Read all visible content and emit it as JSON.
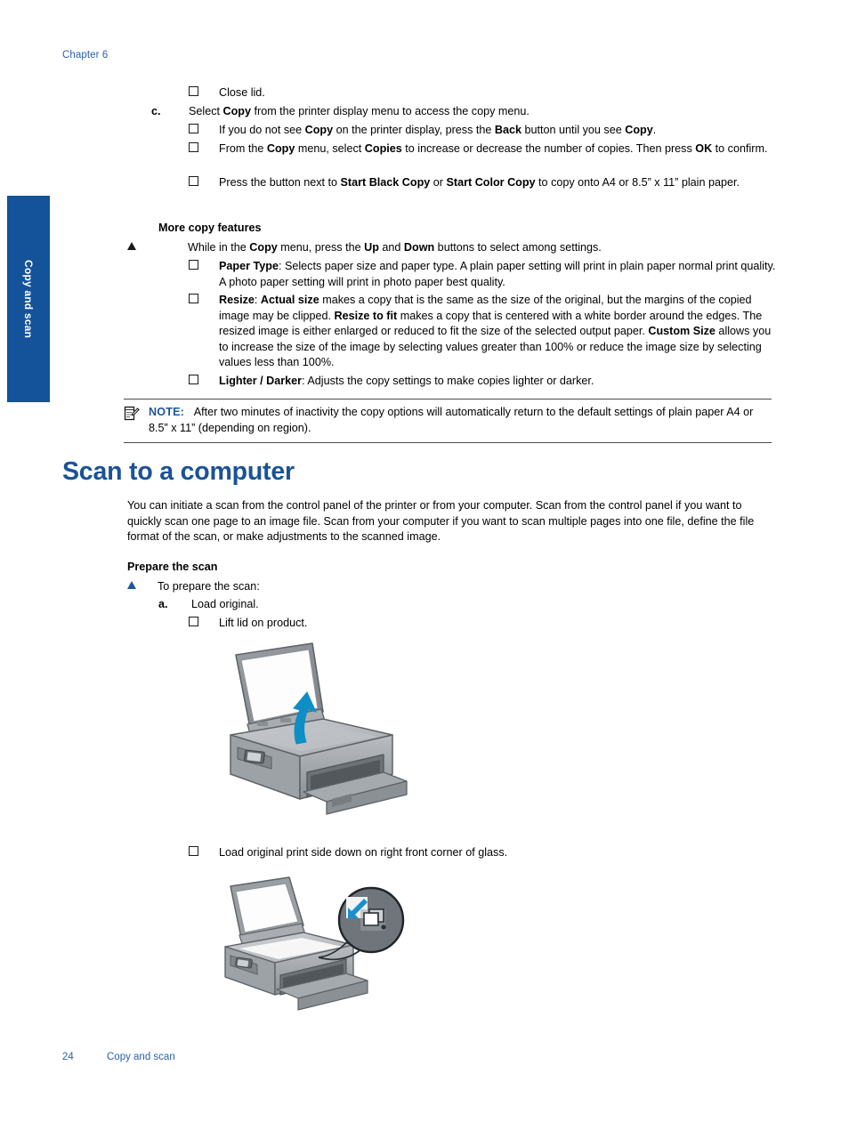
{
  "header": {
    "chapter": "Chapter 6"
  },
  "side_tab": {
    "label": "Copy and scan",
    "color": "#14529a"
  },
  "copy_steps": {
    "close_lid": "Close lid.",
    "step_c_marker": "c.",
    "step_c_parts": [
      "Select ",
      "Copy",
      " from the printer display menu to access the copy menu."
    ],
    "bullets": [
      [
        "If you do not see ",
        "Copy",
        " on the printer display, press the ",
        "Back",
        " button until you see ",
        "Copy",
        "."
      ],
      [
        "From the ",
        "Copy",
        " menu, select ",
        "Copies",
        " to increase or decrease the number of copies. Then press ",
        "OK",
        " to confirm."
      ],
      [
        "Press the button next to ",
        "Start Black Copy",
        " or ",
        "Start Color Copy",
        " to copy onto A4 or 8.5” x 11” plain paper."
      ]
    ]
  },
  "more_copy_features": {
    "title": "More copy features",
    "lead": [
      "While in the ",
      "Copy",
      " menu, press the ",
      "Up",
      " and ",
      "Down",
      " buttons to select among settings."
    ],
    "items": [
      [
        "Paper Type",
        ": Selects paper size and paper type. A plain paper setting will print in plain paper normal print quality. A photo paper setting will print in photo paper best quality."
      ],
      [
        "Resize",
        ": ",
        "Actual size",
        " makes a copy that is the same as the size of the original, but the margins of the copied image may be clipped. ",
        "Resize to fit",
        " makes a copy that is centered with a white border around the edges. The resized image is either enlarged or reduced to fit the size of the selected output paper. ",
        "Custom Size",
        " allows you to increase the size of the image by selecting values greater than 100% or reduce the image size by selecting values less than 100%."
      ],
      [
        "Lighter / Darker",
        ": Adjusts the copy settings to make copies lighter or darker."
      ]
    ]
  },
  "note": {
    "icon": "note-pencil-icon",
    "label": "NOTE:",
    "text": "After two minutes of inactivity the copy options will automatically return to the default settings of plain paper A4 or 8.5” x 11” (depending on region)."
  },
  "scan_section": {
    "heading": "Scan to a computer",
    "intro": "You can initiate a scan from the control panel of the printer or from your computer. Scan from the control panel if you want to quickly scan one page to an image file. Scan from your computer if you want to scan multiple pages into one file, define the file format of the scan, or make adjustments to the scanned image.",
    "prepare_title": "Prepare the scan",
    "prepare_lead": "To prepare the scan:",
    "step_a_marker": "a.",
    "step_a_text": "Load original.",
    "bullet_lift": "Lift lid on product.",
    "bullet_load": "Load original print side down on right front corner of glass."
  },
  "illustrations": {
    "printer_open_lid": {
      "name": "printer-lid-open-illustration",
      "arrow_color": "#0d8ec4"
    },
    "printer_load_corner": {
      "name": "printer-load-corner-illustration",
      "arrow_color": "#1a8fd0"
    }
  },
  "footer": {
    "page_number": "24",
    "section": "Copy and scan"
  },
  "colors": {
    "heading_blue": "#1a5296",
    "link_blue": "#2a5faa",
    "tab_blue": "#14529a",
    "note_blue": "#1d5799"
  }
}
